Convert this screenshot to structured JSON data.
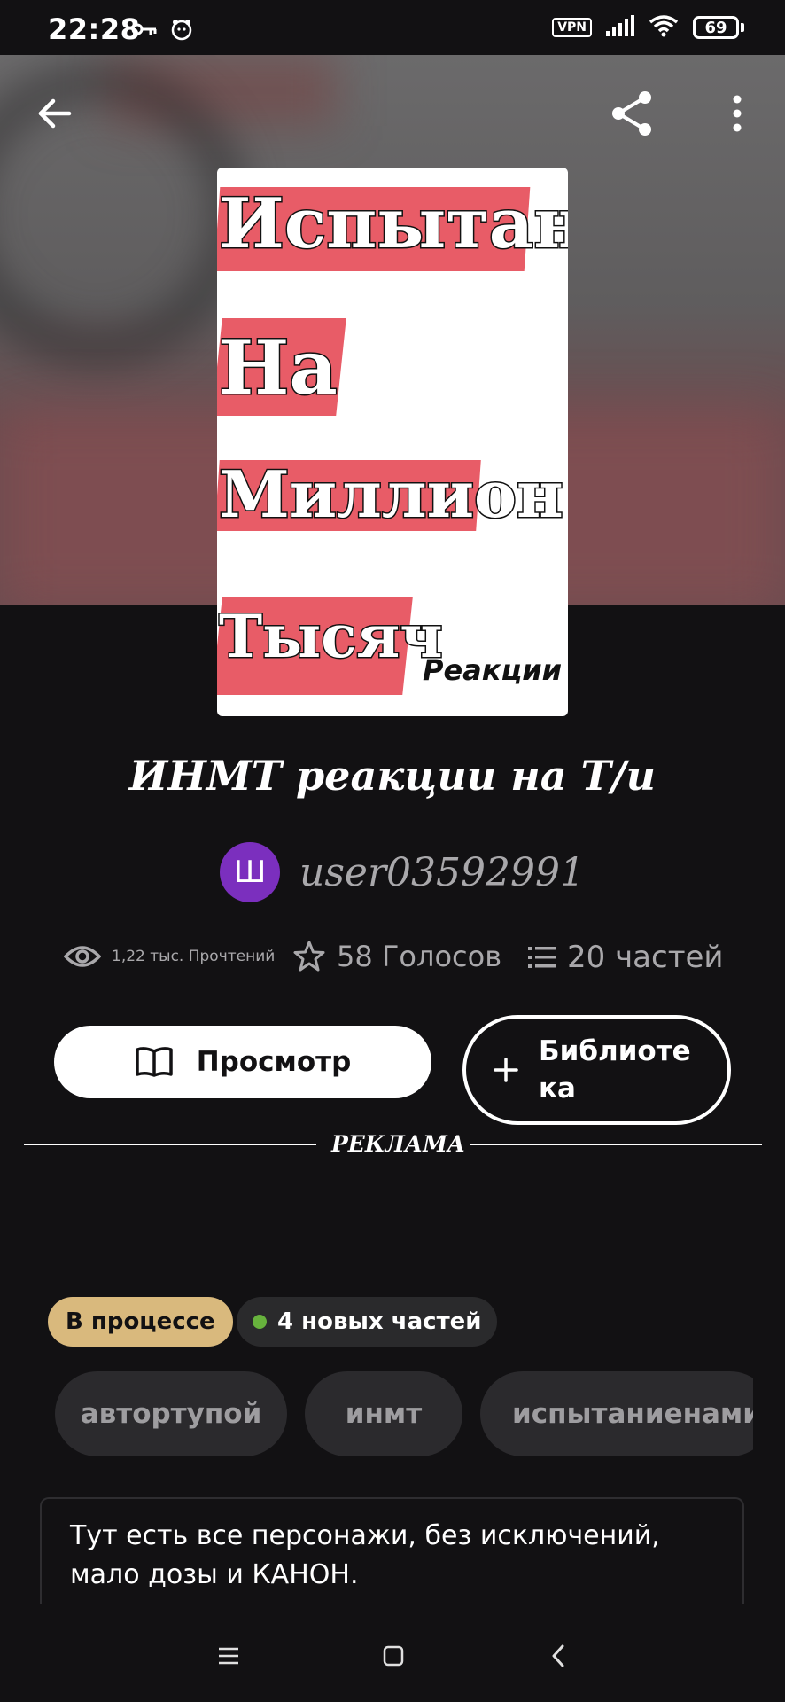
{
  "status_bar": {
    "time": "22:28",
    "vpn": "VPN",
    "battery": "69"
  },
  "topbar": {
    "back_icon": "arrow-left-icon",
    "share_icon": "share-icon",
    "more_icon": "more-vertical-icon"
  },
  "cover": {
    "words": [
      "Испытание",
      "На",
      "Миллион",
      "Тысяч"
    ],
    "tag": "Реакции",
    "accent_color": "#e85c67"
  },
  "story": {
    "title": "ИНМТ реакции на Т/и",
    "author_initial": "Ш",
    "author": "user03592991",
    "reads": "1,22 тыс. Прочтений",
    "votes": "58 Голосов",
    "parts": "20 частей"
  },
  "actions": {
    "read_label": "Просмотр",
    "library_label": "Библиотека"
  },
  "ad_label": "РЕКЛАМА",
  "badges": {
    "status": "В процессе",
    "new_parts": "4 новых частей"
  },
  "tags": [
    "автортупой",
    "инмт",
    "испытаниенамил"
  ],
  "description": "Тут есть все персонажи, без исключений, мало дозы и КАНОН.",
  "colors": {
    "background": "#121113",
    "status_badge": "#d9b97d",
    "avatar": "#7b2fbe",
    "new_dot": "#67b23d"
  }
}
